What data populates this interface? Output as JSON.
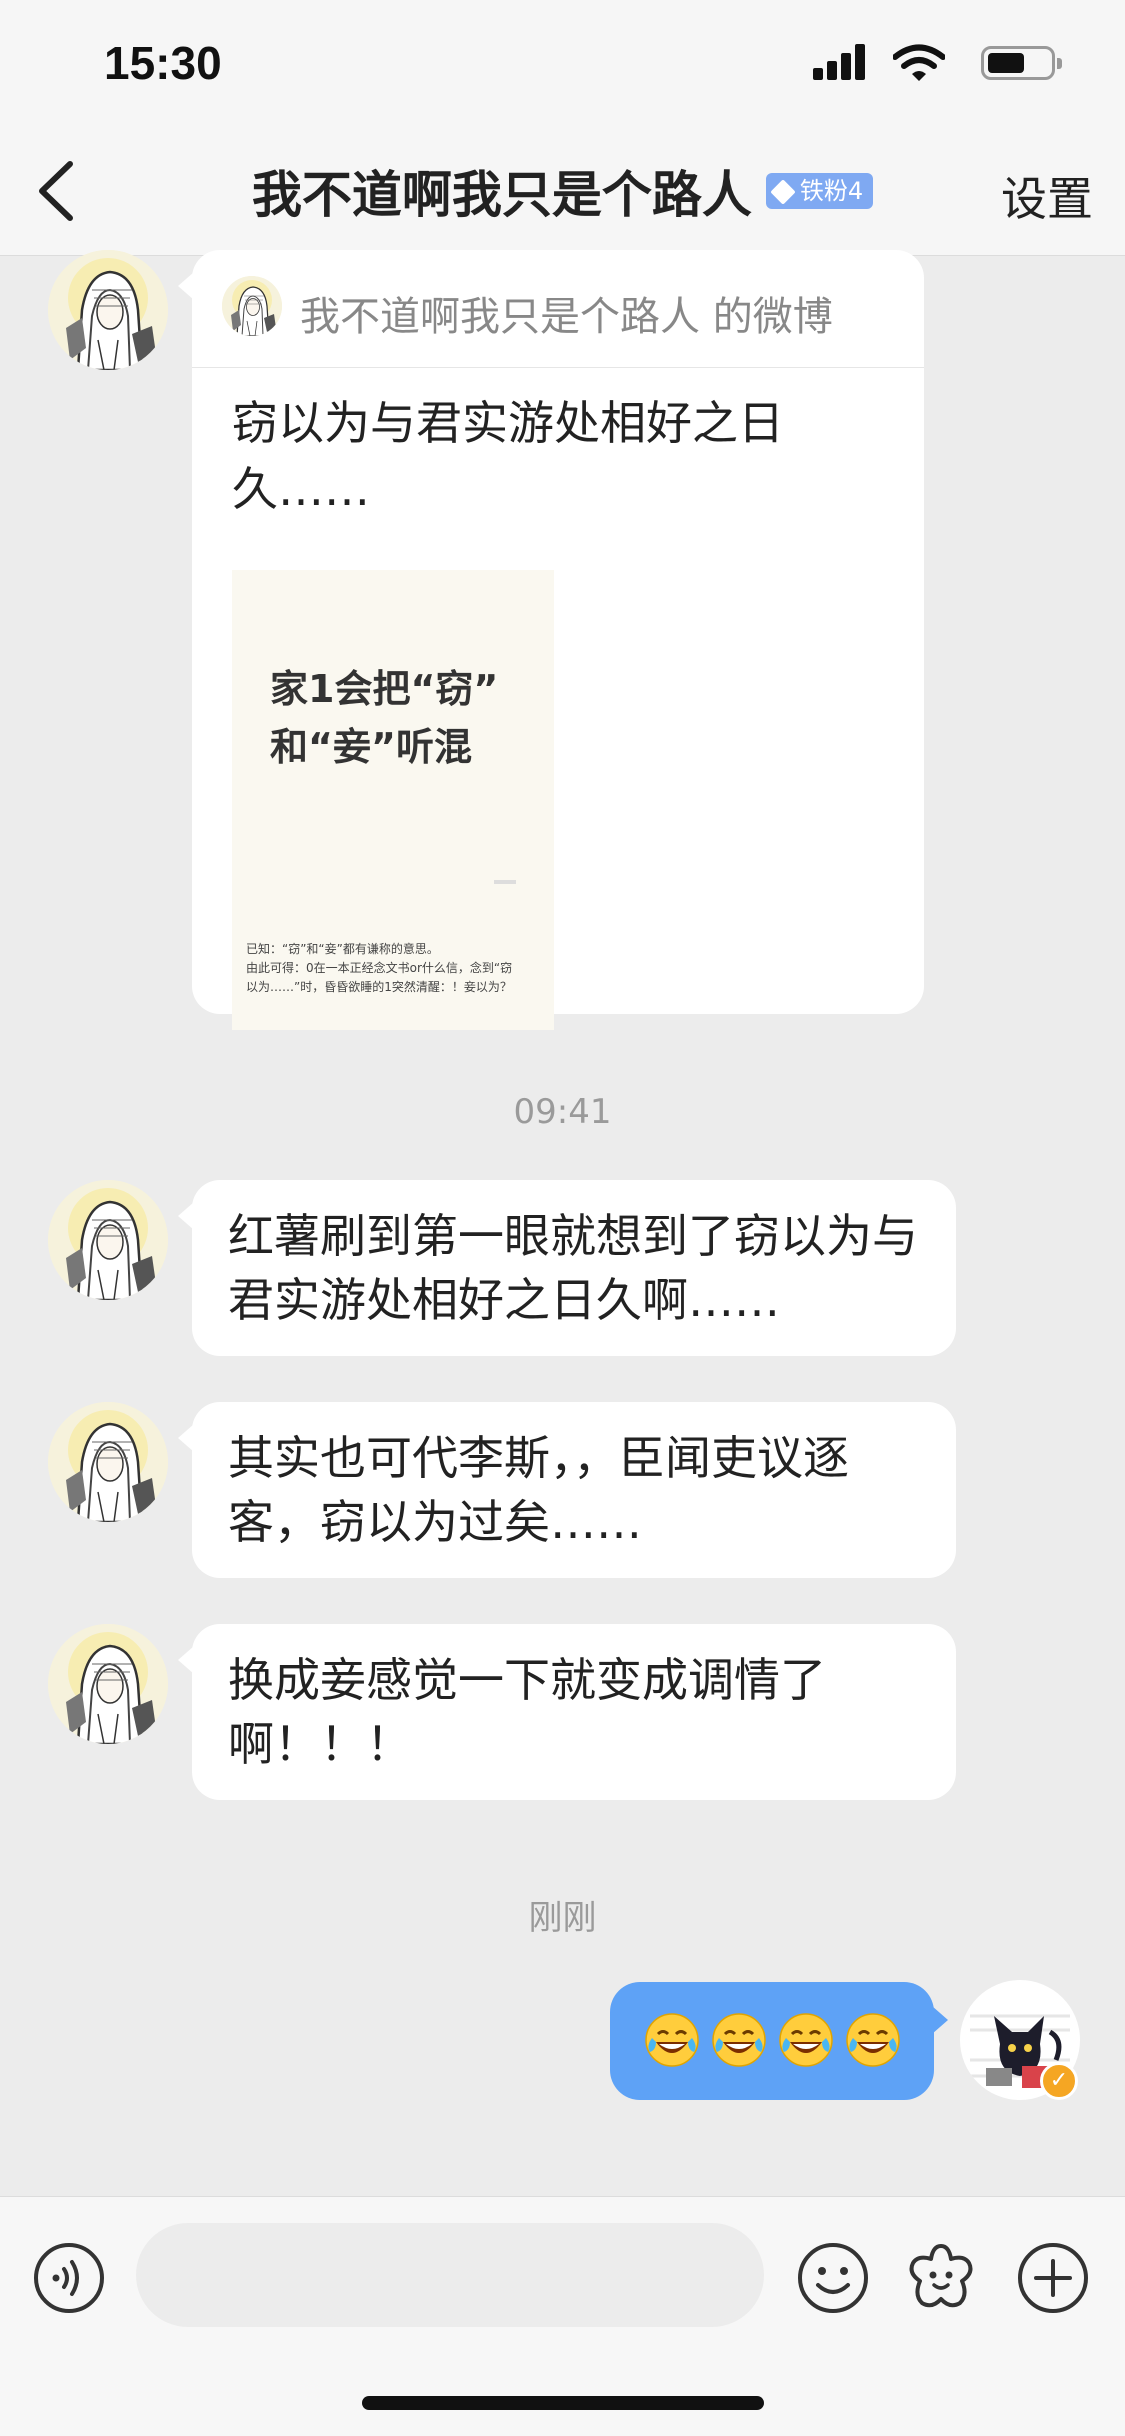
{
  "status_bar": {
    "time": "15:30"
  },
  "nav": {
    "title": "我不道啊我只是个路人",
    "fan_badge": "铁粉4",
    "settings": "设置"
  },
  "shared_card": {
    "source": "我不道啊我只是个路人 的微博",
    "text": "窃以为与君实游处相好之日久……",
    "image": {
      "title_line1": "家1会把“窃”",
      "title_line2": "和“妾”听混",
      "caption_line1": "已知：“窃”和“妾”都有谦称的意思。",
      "caption_line2": "由此可得：0在一本正经念文书or什么信，念到“窃",
      "caption_line3": "以为……”时，昏昏欲睡的1突然清醒：！妾以为？"
    }
  },
  "timestamps": {
    "first": "09:41",
    "second": "刚刚"
  },
  "messages": [
    {
      "text": "红薯刷到第一眼就想到了窃以为与君实游处相好之日久啊……"
    },
    {
      "text": "其实也可代李斯，，臣闻吏议逐客，窃以为过矣……"
    },
    {
      "text": "换成妾感觉一下就变成调情了啊！！！"
    }
  ],
  "my_message": {
    "emojis": [
      "tears-of-joy-icon",
      "tears-of-joy-icon",
      "tears-of-joy-icon",
      "tears-of-joy-icon"
    ]
  },
  "input": {
    "placeholder": ""
  },
  "colors": {
    "my_bubble": "#5ea2f6",
    "fan_badge": "#7fa9f2",
    "verified_badge": "#f5a623",
    "background": "#ececec"
  }
}
